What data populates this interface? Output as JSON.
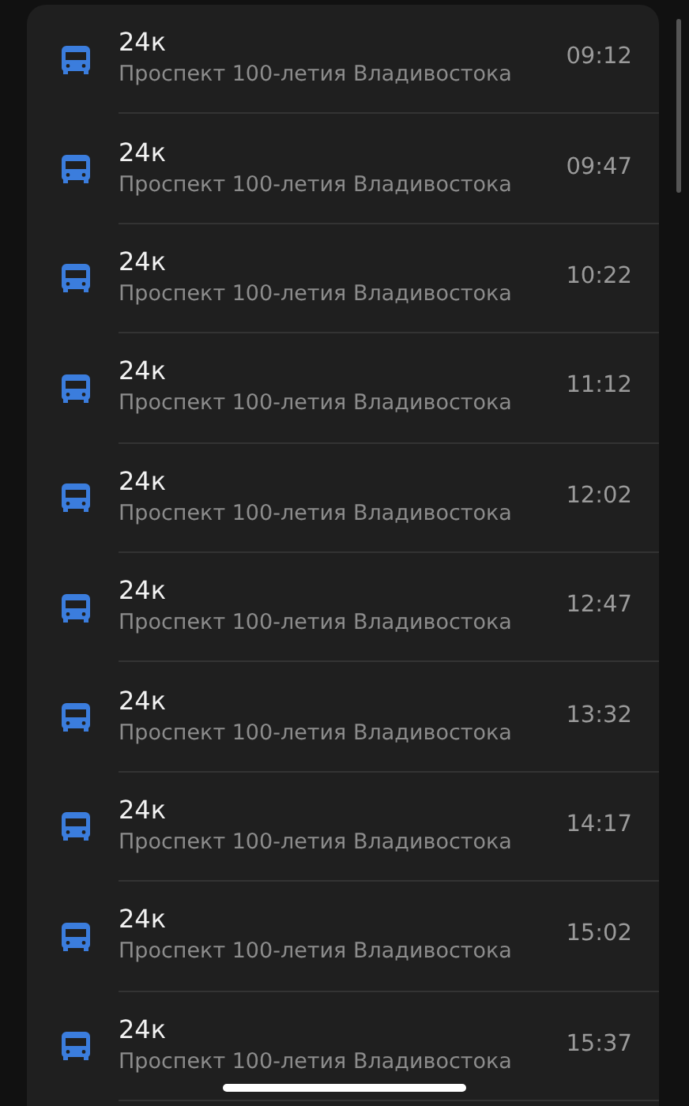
{
  "departures": [
    {
      "route": "24к",
      "stop": "Проспект 100-летия Владивостока",
      "time": "09:12"
    },
    {
      "route": "24к",
      "stop": "Проспект 100-летия Владивостока",
      "time": "09:47"
    },
    {
      "route": "24к",
      "stop": "Проспект 100-летия Владивостока",
      "time": "10:22"
    },
    {
      "route": "24к",
      "stop": "Проспект 100-летия Владивостока",
      "time": "11:12"
    },
    {
      "route": "24к",
      "stop": "Проспект 100-летия Владивостока",
      "time": "12:02"
    },
    {
      "route": "24к",
      "stop": "Проспект 100-летия Владивостока",
      "time": "12:47"
    },
    {
      "route": "24к",
      "stop": "Проспект 100-летия Владивостока",
      "time": "13:32"
    },
    {
      "route": "24к",
      "stop": "Проспект 100-летия Владивостока",
      "time": "14:17"
    },
    {
      "route": "24к",
      "stop": "Проспект 100-летия Владивостока",
      "time": "15:02"
    },
    {
      "route": "24к",
      "stop": "Проспект 100-летия Владивостока",
      "time": "15:37"
    }
  ]
}
